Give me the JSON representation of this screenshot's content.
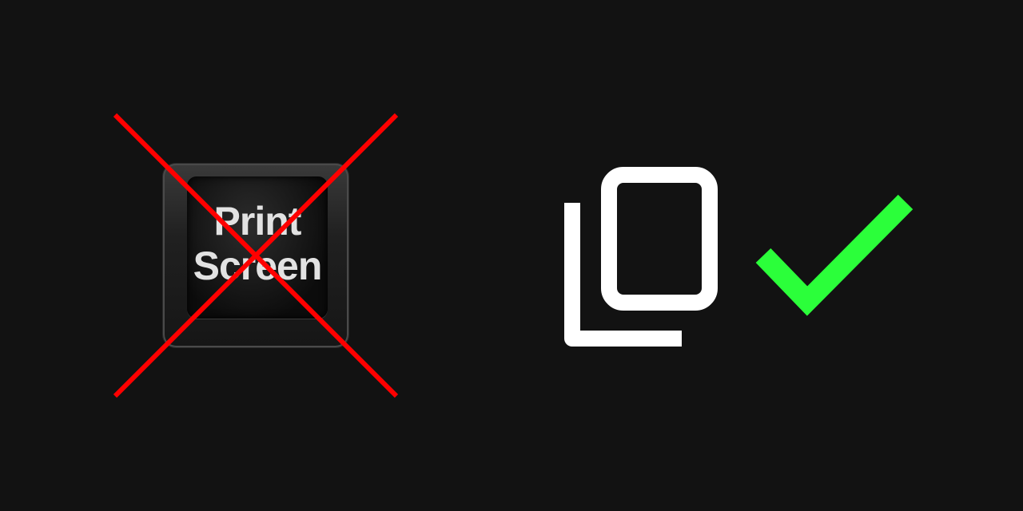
{
  "keycap": {
    "line1": "Print",
    "line2": "Screen"
  },
  "icons": {
    "cross": "red-x-cross-icon",
    "copy": "copy-icon",
    "check": "checkmark-icon"
  },
  "colors": {
    "background": "#121212",
    "cross": "#ff0000",
    "copy": "#ffffff",
    "check": "#2bff3a"
  }
}
